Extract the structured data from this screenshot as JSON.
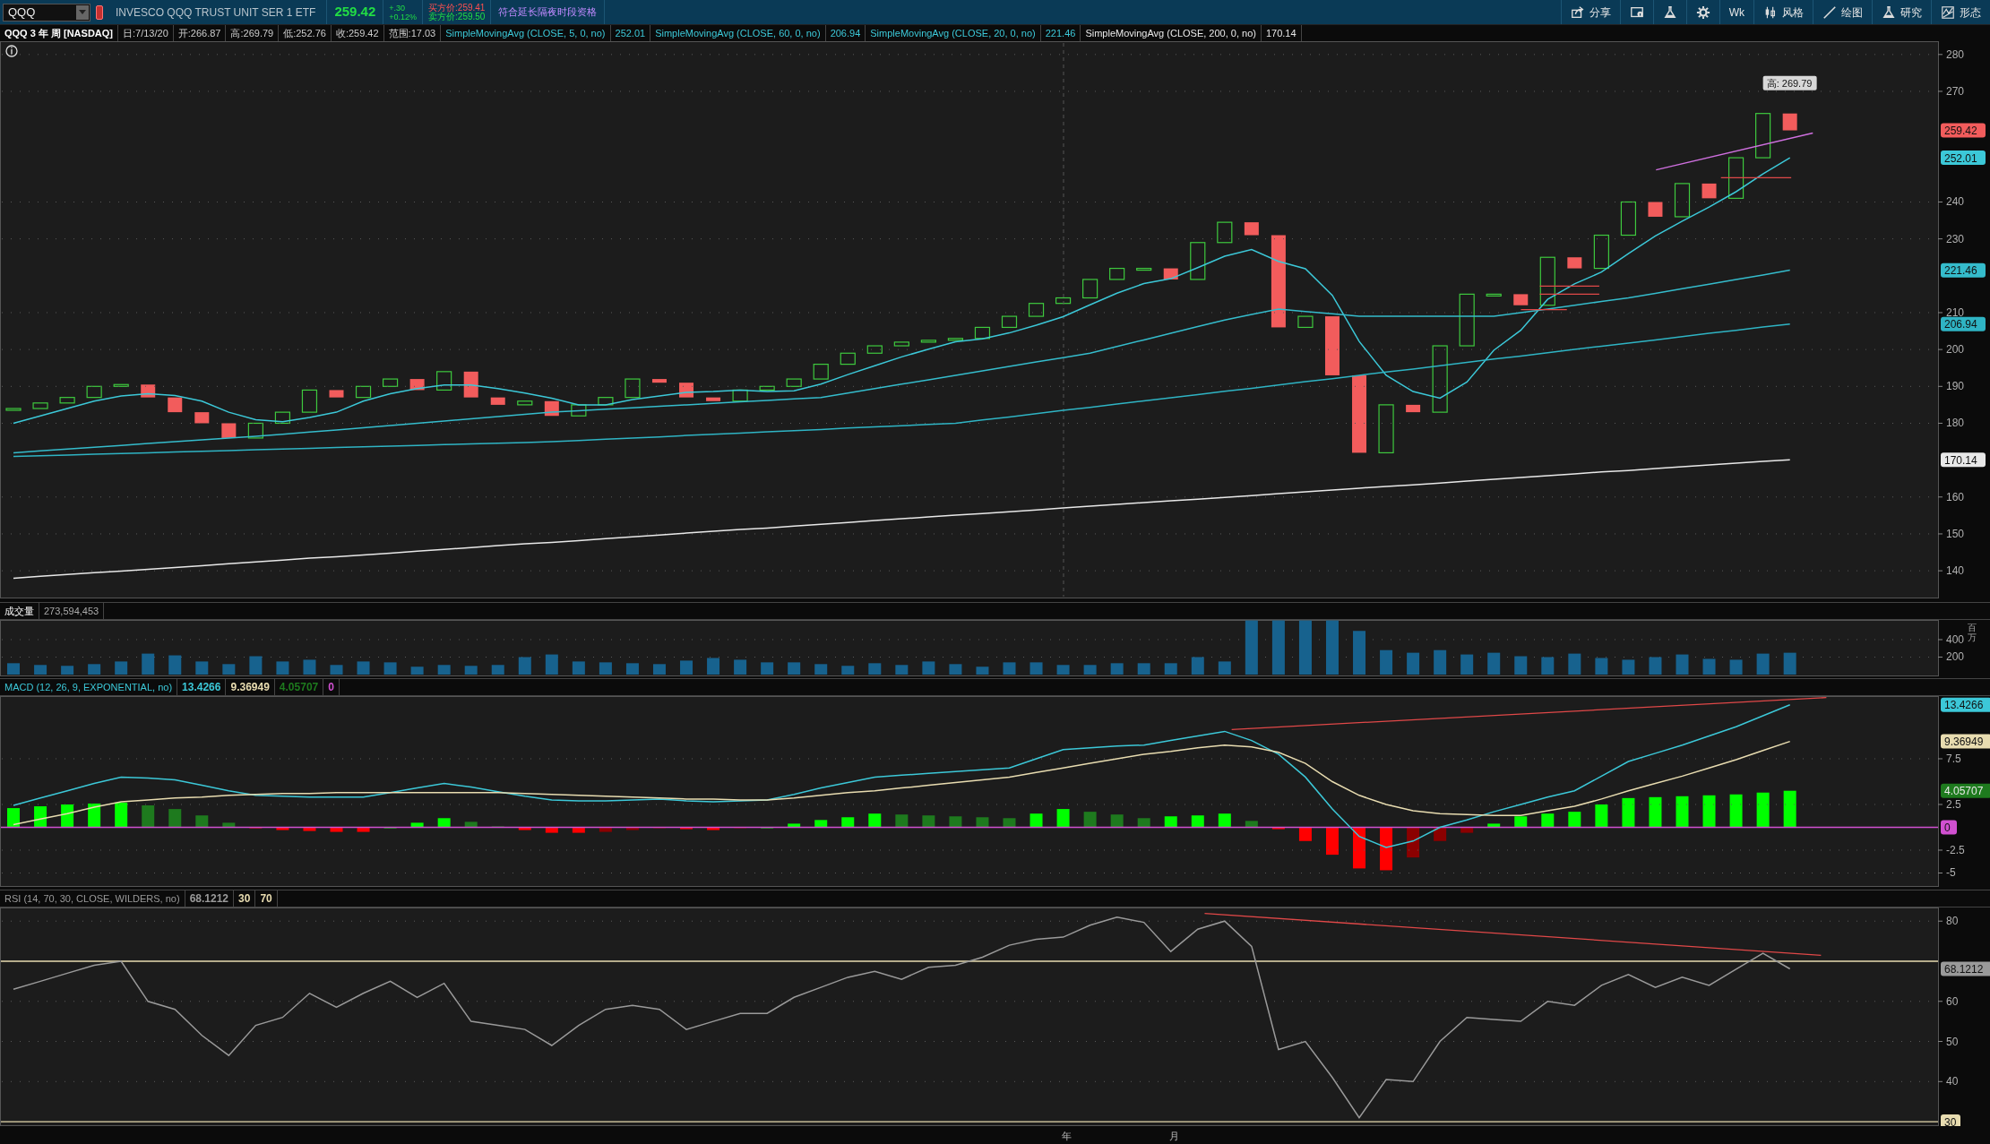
{
  "toolbar": {
    "symbol": "QQQ",
    "description": "INVESCO QQQ TRUST UNIT SER 1 ETF",
    "last": "259.42",
    "change": "+.30",
    "change_pct": "+0.12%",
    "bid": "买方价:259.41",
    "ask": "卖方价:259.50",
    "session_badge": "符合延长隔夜时段资格",
    "buttons": [
      {
        "kind": "share",
        "label": "分享"
      },
      {
        "kind": "card"
      },
      {
        "kind": "flask"
      },
      {
        "kind": "gear"
      },
      {
        "kind": "text",
        "label": "Wk"
      },
      {
        "kind": "candles",
        "label": "风格"
      },
      {
        "kind": "pencil",
        "label": "绘图"
      },
      {
        "kind": "flask",
        "label": "研究"
      },
      {
        "kind": "pattern",
        "label": "形态"
      }
    ]
  },
  "price_panel": {
    "header": {
      "title": "QQQ 3 年 周 [NASDAQ]",
      "fields": [
        "日:7/13/20",
        "开:266.87",
        "高:269.79",
        "低:252.76",
        "收:259.42",
        "范围:17.03"
      ],
      "studies": [
        {
          "label": "SimpleMovingAvg (CLOSE, 5, 0, no)",
          "value": "252.01",
          "color": "#3cc8d8"
        },
        {
          "label": "SimpleMovingAvg (CLOSE, 60, 0, no)",
          "value": "206.94",
          "color": "#3cc8d8"
        },
        {
          "label": "SimpleMovingAvg (CLOSE, 20, 0, no)",
          "value": "221.46",
          "color": "#3cc8d8"
        },
        {
          "label": "SimpleMovingAvg (CLOSE, 200, 0, no)",
          "value": "170.14",
          "color": "#e8e8e8"
        }
      ]
    },
    "high_label": "高: 269.79",
    "tags": [
      {
        "text": "259.42",
        "color": "#f25c5c"
      },
      {
        "text": "252.01",
        "color": "#3cc8d8"
      },
      {
        "text": "221.46",
        "color": "#35bccc"
      },
      {
        "text": "206.94",
        "color": "#2fb4c4"
      },
      {
        "text": "170.14",
        "color": "#e8e8e8"
      }
    ],
    "chart_data": {
      "type": "line",
      "grid": true,
      "ylim": [
        132.5,
        283.6
      ],
      "yticks": [
        140,
        150,
        160,
        180,
        190,
        200,
        210,
        230,
        240,
        270,
        280
      ],
      "series": [
        {
          "color": "#3cc8d8",
          "values": [
            180,
            182,
            184,
            186,
            187.4,
            188,
            187.5,
            186,
            183,
            181,
            180.4,
            181.6,
            183,
            186,
            188,
            189.4,
            190.4,
            190.4,
            189.4,
            188.2,
            186.8,
            185,
            185,
            186.4,
            187.4,
            188.4,
            188.6,
            189,
            188.6,
            188.8,
            190.6,
            193.2,
            195.6,
            198,
            200.1,
            202.1,
            202.9,
            204.5,
            206.6,
            208.9,
            212.1,
            215.3,
            217.9,
            219.2,
            222.2,
            225.3,
            227.1,
            223.9,
            221.9,
            214.7,
            202.2,
            193,
            188.6,
            186.8,
            191.2,
            199.8,
            205.2,
            213.6,
            217.8,
            221,
            226,
            230.8,
            234.8,
            238.6,
            242.8,
            247.6,
            252,
            null,
            null,
            null,
            null,
            null
          ]
        },
        {
          "color": "#2fb4c4",
          "values": [
            171,
            171.2,
            171.4,
            171.6,
            171.8,
            172,
            172.2,
            172.4,
            172.6,
            172.8,
            173,
            173.2,
            173.4,
            173.6,
            173.8,
            174,
            174.2,
            174.4,
            174.6,
            174.8,
            175,
            175.3,
            175.7,
            176,
            176.3,
            176.7,
            177,
            177.3,
            177.7,
            178,
            178.3,
            178.7,
            179,
            179.3,
            179.7,
            180,
            180.9,
            181.7,
            182.6,
            183.5,
            184.3,
            185.2,
            186.1,
            186.9,
            187.8,
            188.7,
            189.5,
            190.4,
            191.3,
            192.1,
            193,
            193.9,
            194.7,
            195.6,
            196.5,
            197.4,
            198.2,
            199.1,
            200,
            200.9,
            201.7,
            202.6,
            203.5,
            204.4,
            205.2,
            206.1,
            206.9,
            null,
            null,
            null,
            null,
            null
          ]
        },
        {
          "color": "#35bccc",
          "values": [
            172,
            172.5,
            173,
            173.5,
            174,
            174.5,
            175,
            175.5,
            176,
            176.5,
            177,
            177.6,
            178.2,
            178.8,
            179.4,
            180,
            180.6,
            181.2,
            181.8,
            182.4,
            183,
            183.4,
            183.8,
            184.2,
            184.6,
            185,
            185.4,
            185.8,
            186.2,
            186.6,
            187,
            188.2,
            189.4,
            190.6,
            191.8,
            193,
            194.2,
            195.4,
            196.6,
            197.8,
            199,
            200.8,
            202.6,
            204.4,
            206.2,
            208,
            209.5,
            211,
            210.3,
            209.7,
            209,
            209,
            209,
            209,
            209,
            209,
            210,
            211,
            212,
            213,
            214,
            215.2,
            216.5,
            217.7,
            219,
            220.2,
            221.5,
            null,
            null,
            null,
            null,
            null
          ]
        },
        {
          "color": "#e8e8e8",
          "values": [
            138,
            138.5,
            139,
            139.5,
            139.9,
            140.4,
            140.9,
            141.4,
            141.9,
            142.4,
            142.9,
            143.4,
            143.8,
            144.3,
            144.8,
            145.3,
            145.8,
            146.3,
            146.8,
            147.3,
            147.7,
            148.2,
            148.7,
            149.2,
            149.7,
            150.2,
            150.7,
            151.2,
            151.6,
            152.1,
            152.6,
            153.1,
            153.6,
            154.1,
            154.6,
            155.1,
            155.5,
            156,
            156.5,
            157,
            157.5,
            158,
            158.5,
            159,
            159.4,
            159.9,
            160.4,
            160.9,
            161.4,
            161.9,
            162.4,
            162.9,
            163.3,
            163.8,
            164.3,
            164.8,
            165.3,
            165.8,
            166.3,
            166.8,
            167.2,
            167.7,
            168.2,
            168.7,
            169.2,
            169.7,
            170.1,
            null,
            null,
            null,
            null,
            null
          ]
        }
      ]
    }
  },
  "volume_panel": {
    "header": {
      "title": "成交量",
      "value": "273,594,453"
    },
    "unit": "百万",
    "chart_data": {
      "type": "bar",
      "grid": true,
      "ylim": [
        -20.5,
        625.6
      ],
      "yticks": [
        200,
        400
      ],
      "series": [
        {
          "color": "#17628e",
          "values": [
            130,
            110,
            100,
            120,
            150,
            240,
            220,
            150,
            120,
            210,
            150,
            170,
            110,
            150,
            140,
            90,
            110,
            100,
            110,
            200,
            230,
            150,
            140,
            130,
            120,
            160,
            190,
            170,
            140,
            140,
            120,
            100,
            130,
            110,
            150,
            120,
            90,
            140,
            140,
            110,
            110,
            130,
            130,
            130,
            200,
            150,
            620,
            620,
            620,
            620,
            500,
            280,
            250,
            280,
            230,
            250,
            210,
            200,
            240,
            190,
            170,
            200,
            230,
            180,
            170,
            240,
            250,
            null,
            null,
            null,
            null,
            null
          ]
        }
      ]
    }
  },
  "macd_panel": {
    "header": {
      "title": "MACD (12, 26, 9, EXPONENTIAL, no)",
      "values": [
        {
          "text": "13.4266",
          "color": "#3cc8d8"
        },
        {
          "text": "9.36949",
          "color": "#e8dcb0"
        },
        {
          "text": "4.05707",
          "color": "#1e7a1e"
        },
        {
          "text": "0",
          "color": "#d050d0"
        }
      ]
    },
    "tags": [
      {
        "text": "13.4266",
        "color": "#3cc8d8"
      },
      {
        "text": "9.36949",
        "color": "#e8dcb0"
      },
      {
        "text": "4.05707",
        "color": "#1e7a1e"
      },
      {
        "text": "0",
        "color": "#d050d0"
      }
    ],
    "chart_data": {
      "type": "line",
      "grid": true,
      "ylim": [
        -6.52,
        14.36
      ],
      "yticks": [
        -5,
        -2.5,
        2.5,
        7.5
      ],
      "series": [
        {
          "color": "#3cc8d8",
          "values": [
            2.4,
            3.2,
            4.0,
            4.8,
            5.5,
            5.4,
            5.2,
            4.6,
            4.0,
            3.5,
            3.4,
            3.3,
            3.3,
            3.3,
            3.8,
            4.3,
            4.8,
            4.4,
            3.9,
            3.4,
            3.0,
            2.9,
            2.9,
            3.0,
            3.1,
            2.9,
            2.8,
            2.9,
            3.0,
            3.6,
            4.3,
            4.9,
            5.5,
            5.7,
            5.9,
            6.1,
            6.3,
            6.5,
            7.5,
            8.5,
            8.7,
            8.9,
            9.0,
            9.5,
            10.0,
            10.5,
            9.5,
            8.0,
            5.5,
            2.0,
            -1.0,
            -2.2,
            -1.5,
            0.0,
            0.8,
            1.7,
            2.5,
            3.3,
            4.0,
            5.6,
            7.2,
            8.1,
            9.0,
            10.0,
            11.0,
            12.2,
            13.4,
            null,
            null,
            null,
            null,
            null
          ]
        },
        {
          "color": "#e8dcb0",
          "values": [
            0.3,
            0.9,
            1.5,
            2.2,
            2.8,
            3.0,
            3.2,
            3.3,
            3.5,
            3.6,
            3.7,
            3.7,
            3.8,
            3.8,
            3.8,
            3.8,
            3.8,
            3.8,
            3.8,
            3.7,
            3.6,
            3.5,
            3.4,
            3.3,
            3.2,
            3.1,
            3.1,
            3.0,
            3.0,
            3.2,
            3.5,
            3.8,
            4.0,
            4.3,
            4.6,
            4.9,
            5.2,
            5.5,
            6.0,
            6.5,
            7.0,
            7.5,
            8.0,
            8.3,
            8.7,
            9.0,
            8.8,
            8.2,
            7.0,
            5.0,
            3.5,
            2.5,
            1.8,
            1.5,
            1.4,
            1.3,
            1.3,
            1.8,
            2.3,
            3.1,
            4.0,
            4.8,
            5.6,
            6.5,
            7.4,
            8.4,
            9.4,
            null,
            null,
            null,
            null,
            null
          ]
        }
      ]
    }
  },
  "rsi_panel": {
    "header": {
      "title": "RSI (14, 70, 30, CLOSE, WILDERS, no)",
      "values": [
        {
          "text": "68.1212",
          "color": "#9a9a9a"
        },
        {
          "text": "30",
          "color": "#e8dcb0"
        },
        {
          "text": "70",
          "color": "#e8dcb0"
        }
      ]
    },
    "tags": [
      {
        "text": "68.1212",
        "color": "#9a9a9a"
      },
      {
        "text": "30",
        "color": "#e8dcb0"
      }
    ],
    "chart_data": {
      "type": "line",
      "grid": true,
      "ylim": [
        28.9,
        83.4
      ],
      "yticks": [
        40,
        50,
        60,
        80
      ],
      "series": [
        {
          "color": "#9a9a9a",
          "values": [
            63,
            65,
            67,
            69,
            70,
            60,
            58,
            51.5,
            46.5,
            54,
            56,
            62,
            58.5,
            62,
            65,
            61,
            64.5,
            55,
            54,
            53,
            49,
            54,
            58,
            59,
            58,
            53,
            55,
            57,
            57,
            61,
            63.5,
            66,
            67.5,
            65.5,
            68.5,
            69,
            71,
            74,
            75.5,
            76,
            79,
            81,
            79.7,
            72.4,
            78,
            80,
            73.7,
            48,
            50,
            41,
            31,
            40.5,
            40,
            50,
            56,
            55.5,
            55,
            60,
            59,
            64,
            66.7,
            63.5,
            66,
            64,
            68,
            72,
            68.1,
            null,
            null,
            null,
            null,
            null
          ]
        }
      ]
    }
  },
  "time_axis": [
    "年",
    "月"
  ]
}
